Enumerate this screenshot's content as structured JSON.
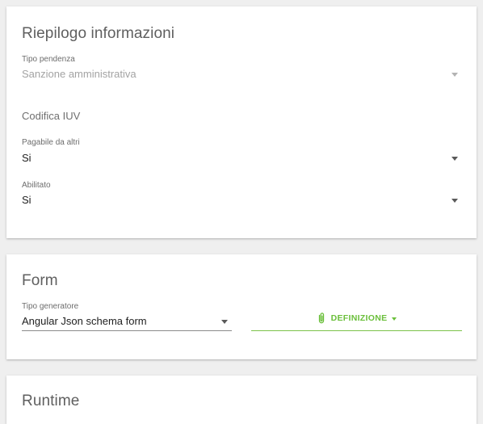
{
  "riepilogo": {
    "title": "Riepilogo informazioni",
    "tipo_pendenza": {
      "label": "Tipo pendenza",
      "value": "Sanzione amministrativa"
    },
    "codifica_iuv": {
      "label": "Codifica IUV"
    },
    "pagabile_da_altri": {
      "label": "Pagabile da altri",
      "value": "Si"
    },
    "abilitato": {
      "label": "Abilitato",
      "value": "Si"
    }
  },
  "form": {
    "title": "Form",
    "tipo_generatore": {
      "label": "Tipo generatore",
      "value": "Angular Json schema form"
    },
    "definizione_button": {
      "label": "DEFINIZIONE",
      "icon": "paperclip-icon"
    }
  },
  "runtime": {
    "title": "Runtime"
  },
  "colors": {
    "accent_green": "#6abf3a",
    "background": "#efefef",
    "card": "#ffffff"
  }
}
